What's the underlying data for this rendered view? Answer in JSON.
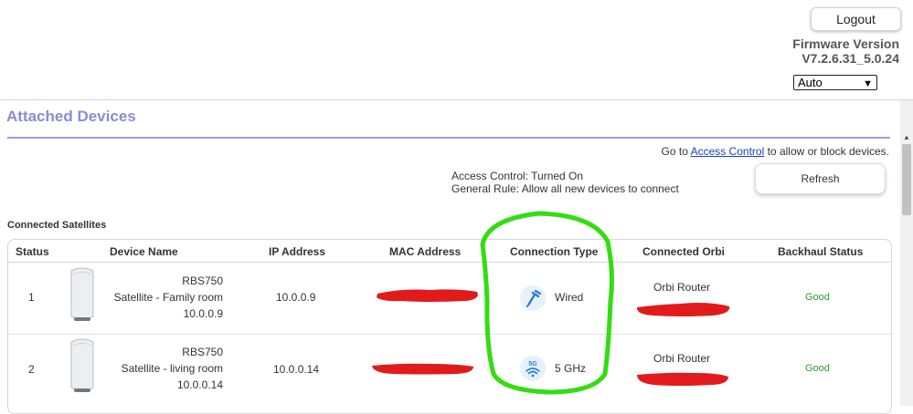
{
  "header": {
    "logout_label": "Logout",
    "firmware_label": "Firmware Version",
    "firmware_version": "V7.2.6.31_5.0.24",
    "language_selected": "Auto"
  },
  "page": {
    "title": "Attached Devices",
    "access_control_prefix": "Go to ",
    "access_control_link": "Access Control",
    "access_control_suffix": " to allow or block devices.",
    "access_control_status": "Access Control: Turned On",
    "general_rule": "General Rule: Allow all new devices to connect",
    "refresh_label": "Refresh",
    "section_label": "Connected Satellites"
  },
  "table": {
    "columns": [
      "Status",
      "Device Name",
      "IP Address",
      "MAC Address",
      "Connection Type",
      "Connected Orbi",
      "Backhaul Status"
    ],
    "rows": [
      {
        "status": "1",
        "model": "RBS750",
        "name": "Satellite - Family room",
        "ip_sub": "10.0.0.9",
        "ip": "10.0.0.9",
        "mac": "",
        "connection_type": "Wired",
        "connection_icon": "wired-plug-icon",
        "connected_orbi": "Orbi Router",
        "backhaul": "Good"
      },
      {
        "status": "2",
        "model": "RBS750",
        "name": "Satellite - living room",
        "ip_sub": "10.0.0.14",
        "ip": "10.0.0.14",
        "mac": "",
        "connection_type": "5 GHz",
        "connection_icon": "wifi-5g-icon",
        "connected_orbi": "Orbi Router",
        "backhaul": "Good"
      }
    ]
  },
  "colors": {
    "title": "#8a8ad8",
    "link": "#1a3fc7",
    "good": "#2a9d2a",
    "annotation_green": "#33dd11",
    "redaction_red": "#e11b1b"
  }
}
